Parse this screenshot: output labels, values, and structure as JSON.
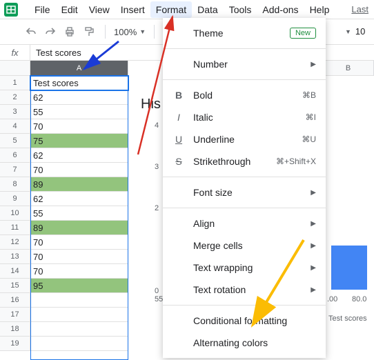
{
  "menubar": {
    "items": [
      "File",
      "Edit",
      "View",
      "Insert",
      "Format",
      "Data",
      "Tools",
      "Add-ons",
      "Help"
    ],
    "last": "Last"
  },
  "toolbar": {
    "zoom": "100%",
    "font_size": "10"
  },
  "formula_bar": {
    "fx": "fx",
    "content": "Test scores"
  },
  "columns": {
    "A": "A",
    "B": "B"
  },
  "rows": [
    {
      "n": "1",
      "v": "Test scores",
      "hl": false,
      "active": true
    },
    {
      "n": "2",
      "v": "62",
      "hl": false
    },
    {
      "n": "3",
      "v": "55",
      "hl": false
    },
    {
      "n": "4",
      "v": "70",
      "hl": false
    },
    {
      "n": "5",
      "v": "75",
      "hl": true
    },
    {
      "n": "6",
      "v": "62",
      "hl": false
    },
    {
      "n": "7",
      "v": "70",
      "hl": false
    },
    {
      "n": "8",
      "v": "89",
      "hl": true
    },
    {
      "n": "9",
      "v": "62",
      "hl": false
    },
    {
      "n": "10",
      "v": "55",
      "hl": false
    },
    {
      "n": "11",
      "v": "89",
      "hl": true
    },
    {
      "n": "12",
      "v": "70",
      "hl": false
    },
    {
      "n": "13",
      "v": "70",
      "hl": false
    },
    {
      "n": "14",
      "v": "70",
      "hl": false
    },
    {
      "n": "15",
      "v": "95",
      "hl": true
    },
    {
      "n": "16",
      "v": "",
      "hl": false
    },
    {
      "n": "17",
      "v": "",
      "hl": false
    },
    {
      "n": "18",
      "v": "",
      "hl": false
    },
    {
      "n": "19",
      "v": "",
      "hl": false
    }
  ],
  "dropdown": {
    "theme": "Theme",
    "new_badge": "New",
    "number": "Number",
    "bold": {
      "label": "Bold",
      "sc": "⌘B"
    },
    "italic": {
      "label": "Italic",
      "sc": "⌘I"
    },
    "underline": {
      "label": "Underline",
      "sc": "⌘U"
    },
    "strike": {
      "label": "Strikethrough",
      "sc": "⌘+Shift+X"
    },
    "font_size": "Font size",
    "align": "Align",
    "merge": "Merge cells",
    "wrap": "Text wrapping",
    "rotation": "Text rotation",
    "cond": "Conditional formatting",
    "alt": "Alternating colors"
  },
  "chart": {
    "title_part": "His",
    "y_ticks": [
      "4",
      "3",
      "2",
      "0"
    ],
    "x_ticks_left": "55",
    "x_ticks_right": [
      ".00",
      "80.0"
    ],
    "x_label": "Test scores"
  }
}
